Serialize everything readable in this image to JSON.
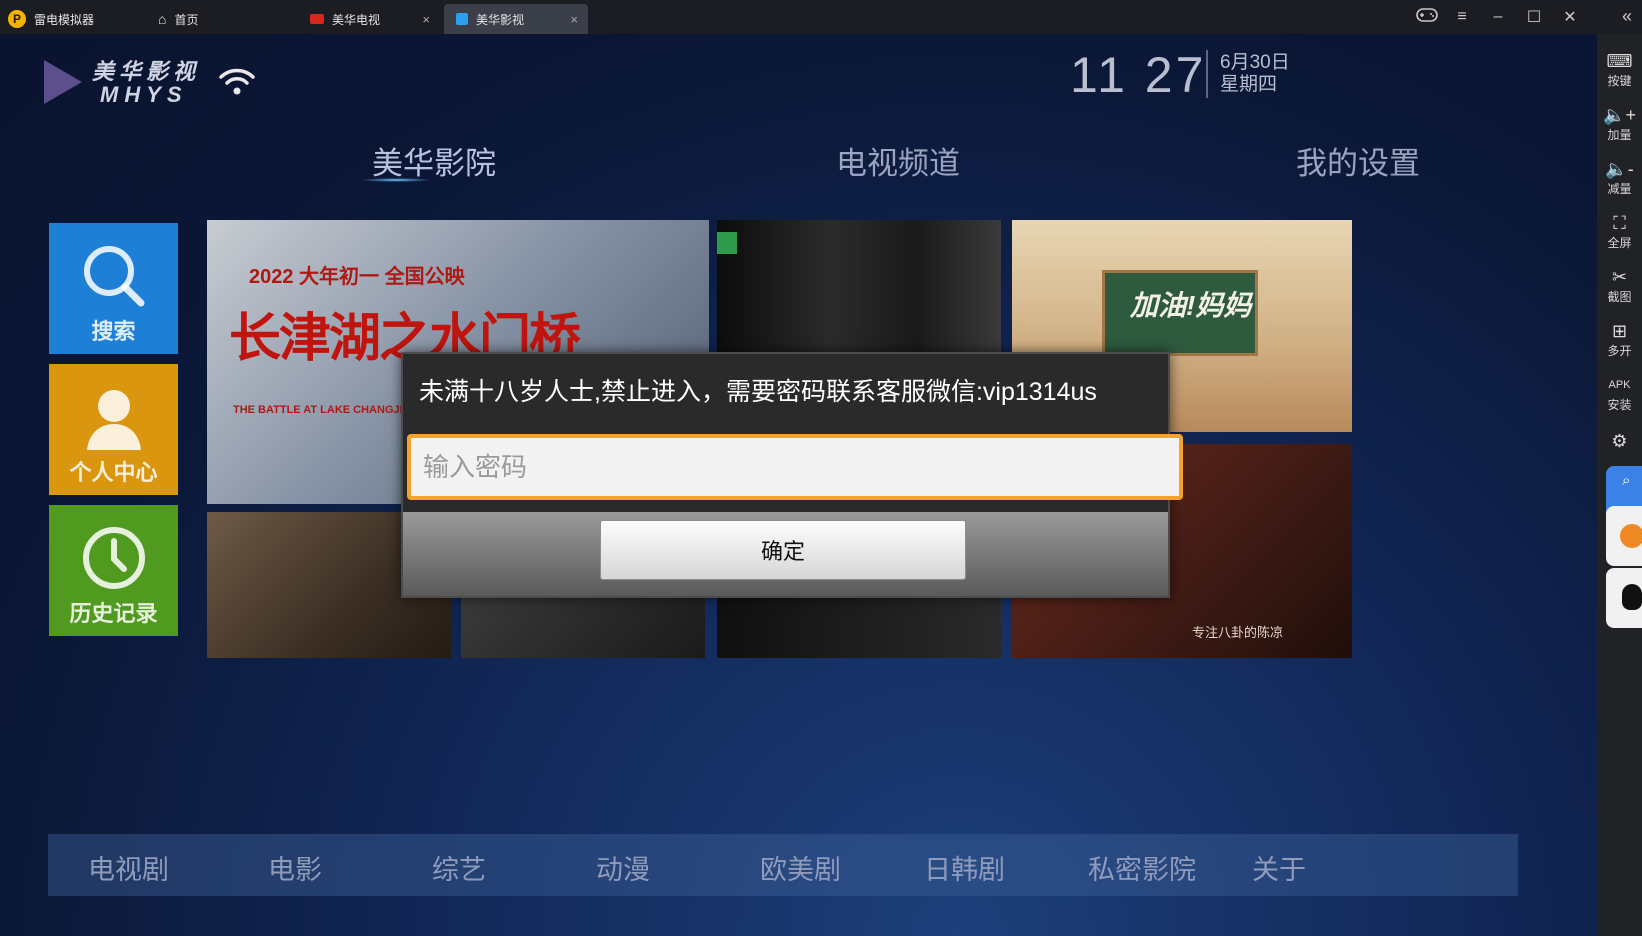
{
  "titlebar": {
    "tabs": [
      {
        "label": "雷电模拟器"
      },
      {
        "label": "首页"
      },
      {
        "label": "美华电视"
      },
      {
        "label": "美华影视"
      }
    ],
    "close_glyph": "×",
    "controls": [
      "gamepad-icon",
      "menu-icon",
      "minimize-icon",
      "maximize-icon",
      "close-icon",
      "collapse-icon"
    ]
  },
  "sidebar": {
    "items": [
      {
        "label": "按键",
        "icon": "keyboard-icon"
      },
      {
        "label": "加量",
        "icon": "volume-up-icon"
      },
      {
        "label": "减量",
        "icon": "volume-down-icon"
      },
      {
        "label": "全屏",
        "icon": "fullscreen-icon"
      },
      {
        "label": "截图",
        "icon": "scissors-icon"
      },
      {
        "label": "多开",
        "icon": "multi-instance-icon"
      },
      {
        "label": "安装",
        "icon": "apk-icon"
      },
      {
        "label": "",
        "icon": "settings-icon"
      }
    ]
  },
  "app": {
    "logo_cn": "美华影视",
    "logo_en": "MHYS",
    "time": "11 27",
    "date": "6月30日",
    "weekday": "星期四",
    "nav": [
      {
        "label": "美华影院",
        "active": true
      },
      {
        "label": "电视频道",
        "active": false
      },
      {
        "label": "我的设置",
        "active": false
      }
    ],
    "tiles": [
      {
        "label": "搜索",
        "color": "#1e7fd6",
        "icon": "search-icon"
      },
      {
        "label": "个人中心",
        "color": "#d9960e",
        "icon": "user-icon"
      },
      {
        "label": "历史记录",
        "color": "#4f9a1f",
        "icon": "clock-icon"
      }
    ],
    "posters": {
      "p1_year": "2022 大年初一 全国公映",
      "p1_title": "长津湖之水门桥",
      "p1_en": "THE BATTLE AT LAKE CHANGJIN",
      "p3_title": "加油!妈妈",
      "p6_caption": "专注八卦的陈凉"
    },
    "categories": [
      "电视剧",
      "电影",
      "综艺",
      "动漫",
      "欧美剧",
      "日韩剧",
      "私密影院",
      "关于"
    ]
  },
  "dialog": {
    "message": "未满十八岁人士,禁止进入，需要密码联系客服微信:vip1314us",
    "input_placeholder": "输入密码",
    "input_value": "",
    "confirm_label": "确定"
  },
  "colors": {
    "accent": "#f7a22b",
    "screen_bg": "#0b1736",
    "tab_active": "#3a3f49"
  }
}
